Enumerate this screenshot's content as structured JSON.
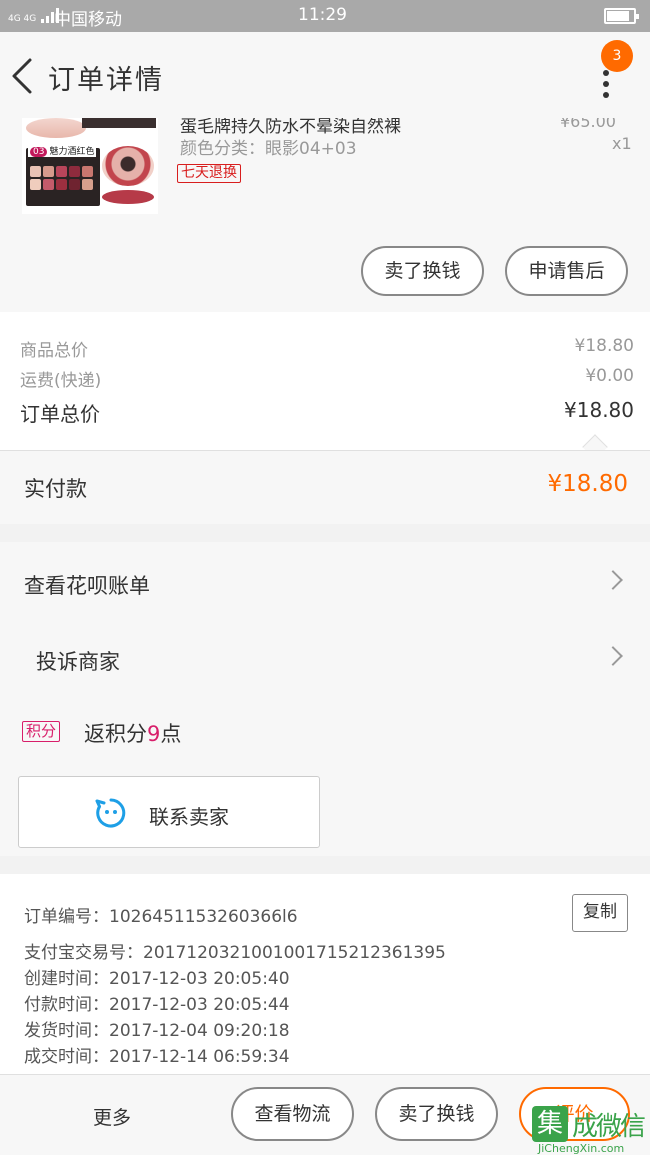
{
  "status_bar": {
    "network": "4G 4G",
    "carrier": "中国移动",
    "time": "11:29",
    "battery_level": 0.85
  },
  "nav": {
    "title": "订单详情",
    "badge_count": "3"
  },
  "product": {
    "name": "蛋毛牌持久防水不晕染自然裸",
    "sku": "颜色分类：眼影04+03",
    "price": "¥65.00",
    "qty": "x1",
    "thumb_tag_num": "03",
    "thumb_tag_text": "魅力酒红色",
    "return_badge": "七天退换",
    "buttons": {
      "sell": "卖了换钱",
      "after_sale": "申请售后"
    }
  },
  "prices": {
    "goods_label": "商品总价",
    "goods_value": "¥18.80",
    "shipping_label": "运费(快递)",
    "shipping_value": "¥0.00",
    "total_label": "订单总价",
    "total_value": "¥18.80"
  },
  "payment": {
    "label": "实付款",
    "value": "¥18.80"
  },
  "menu": {
    "huabei": "查看花呗账单",
    "complain": "投诉商家",
    "points_badge": "积分",
    "points_prefix": "返积分",
    "points_num": "9",
    "points_suffix": "点",
    "contact": "联系卖家"
  },
  "order_info": {
    "order_no": "订单编号：1026451153260366l6",
    "alipay_no": "支付宝交易号：2017120321001001715212361395",
    "created": "创建时间：2017-12-03  20:05:40",
    "paid": "付款时间：2017-12-03  20:05:44",
    "shipped": "发货时间：2017-12-04  09:20:18",
    "completed": "成交时间：2017-12-14  06:59:34",
    "copy": "复制"
  },
  "bottom_bar": {
    "more": "更多",
    "logistics": "查看物流",
    "sell": "卖了换钱",
    "review": "评价"
  },
  "watermark": {
    "logo": "集",
    "text": "成微信",
    "url": "JiChengXin.com"
  },
  "colors": {
    "accent": "#ff6a00",
    "badge_red": "#d81e1e",
    "points_pink": "#d81e6a"
  }
}
